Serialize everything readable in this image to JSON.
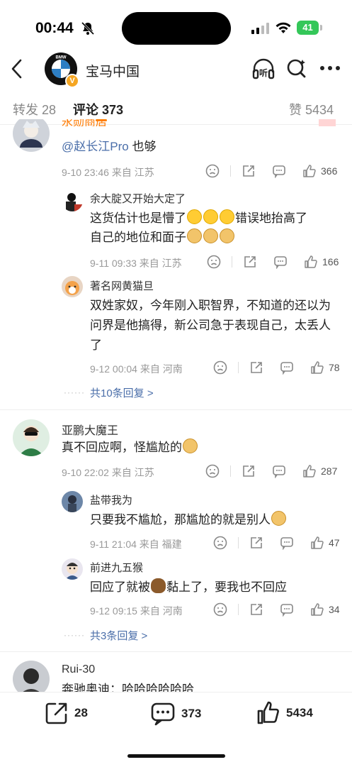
{
  "status_bar": {
    "time": "00:44",
    "battery": "41"
  },
  "nav": {
    "title": "宝马中国",
    "avatar_text": "BMW"
  },
  "tabs": [
    {
      "label": "转发 28"
    },
    {
      "label": "评论 373"
    },
    {
      "label": "赞 5434"
    }
  ],
  "comments": {
    "c0": {
      "user": "永勋商店",
      "mention": "@赵长江Pro",
      "text": " 也够",
      "meta": "9-10 23:46  来自 江苏",
      "likes": "366"
    },
    "r1": {
      "user": "余大腚又开始大定了",
      "text_a": "这货估计也是懵了",
      "text_b": "错误地抬高了",
      "text_c": "自己的地位和面子",
      "meta": "9-11 09:33  来自 江苏",
      "likes": "166"
    },
    "r2": {
      "user": "著名网黄猫旦",
      "text": "双姓家奴，今年刚入职智界，不知道的还以为问界是他搞得，新公司急于表现自己，太丢人了",
      "meta": "9-12 00:04  来自 河南",
      "likes": "78"
    },
    "more1": "共10条回复 >",
    "c1": {
      "user": "亚鹏大魔王",
      "text": "真不回应啊，怪尴尬的",
      "meta": "9-10 22:02  来自 江苏",
      "likes": "287"
    },
    "r3": {
      "user": "盐带我为",
      "text": "只要我不尴尬，那尴尬的就是别人",
      "meta": "9-11 21:04  来自 福建",
      "likes": "47"
    },
    "r4": {
      "user": "前进九五猴",
      "text_a": "回应了就被",
      "text_b": "黏上了，要我也不回应",
      "meta": "9-12 09:15  来自 河南",
      "likes": "34"
    },
    "more2": "共3条回复 >",
    "c2": {
      "user": "Rui-30",
      "text": "奔驰奥迪：哈哈哈哈哈哈"
    }
  },
  "bottom_bar": {
    "repost": "28",
    "comment": "373",
    "like": "5434"
  },
  "colors": {
    "accent": "#ff8200",
    "link": "#4a6ea9",
    "battery": "#34c759"
  },
  "icons": [
    "back-icon",
    "headphones-icon",
    "search-icon",
    "more-icon",
    "dislike-icon",
    "share-icon",
    "comment-icon",
    "like-icon",
    "repost-icon"
  ]
}
